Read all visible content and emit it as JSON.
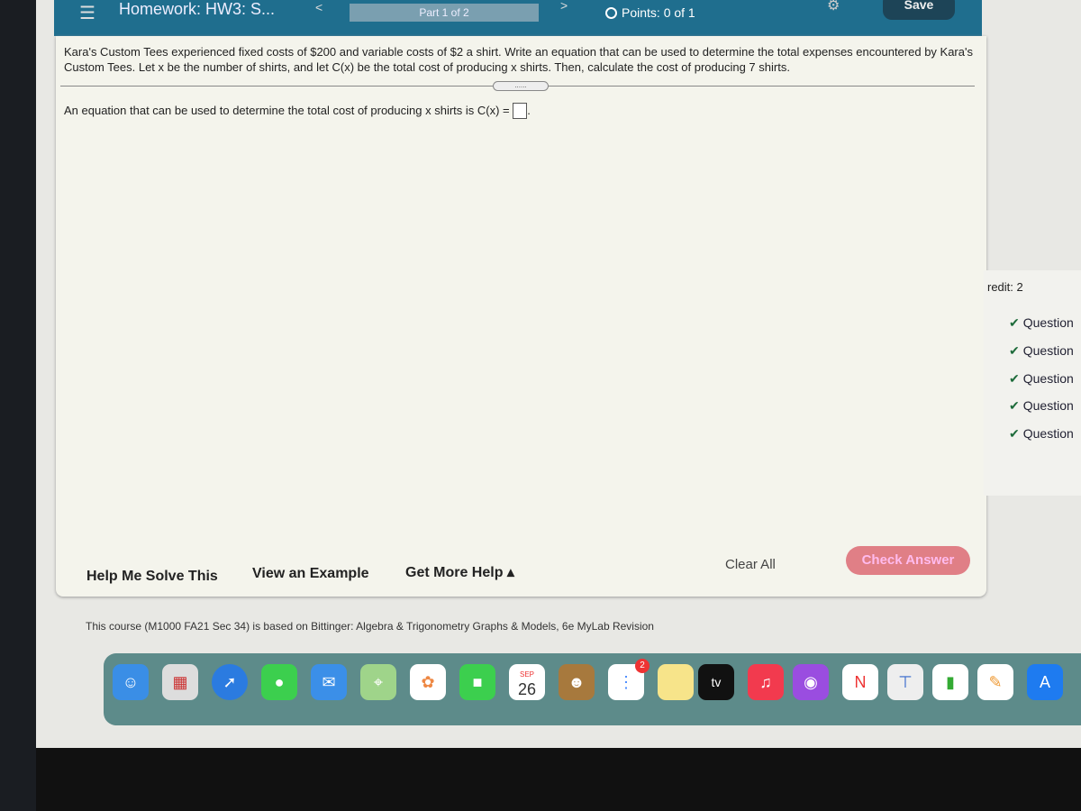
{
  "header": {
    "title": "Homework: HW3: S...",
    "part": "Part 1 of 2",
    "points": "Points: 0 of 1",
    "save": "Save",
    "prev": "<",
    "next": ">"
  },
  "question": {
    "text": "Kara's Custom Tees experienced fixed costs of $200 and variable costs of $2 a shirt. Write an equation that can be used to determine the total expenses encountered by Kara's Custom Tees. Let x be the number of shirts, and let C(x) be the total cost of producing x shirts. Then, calculate the cost of producing 7 shirts.",
    "expand_dots": "......",
    "answer_prompt": "An equation that can be used to determine the total cost of producing x shirts is C(x) =",
    "answer_value": ""
  },
  "actions": {
    "help": "Help Me Solve This",
    "example": "View an Example",
    "more_help": "Get More Help ▴",
    "clear": "Clear All",
    "check": "Check Answer"
  },
  "footer": "This course (M1000 FA21 Sec 34) is based on Bittinger: Algebra & Trigonometry Graphs & Models, 6e MyLab Revision",
  "sidebar": {
    "credit": "redit: 2",
    "items": [
      "Question",
      "Question",
      "Question",
      "Question",
      "Question"
    ]
  },
  "dock": {
    "calendar_month": "SEP",
    "calendar_day": "26",
    "tv": "tv",
    "reminders_badge": "2"
  },
  "colors": {
    "header": "#1f6e8e",
    "check_answer": "#e07f86",
    "save": "#1d4457"
  }
}
